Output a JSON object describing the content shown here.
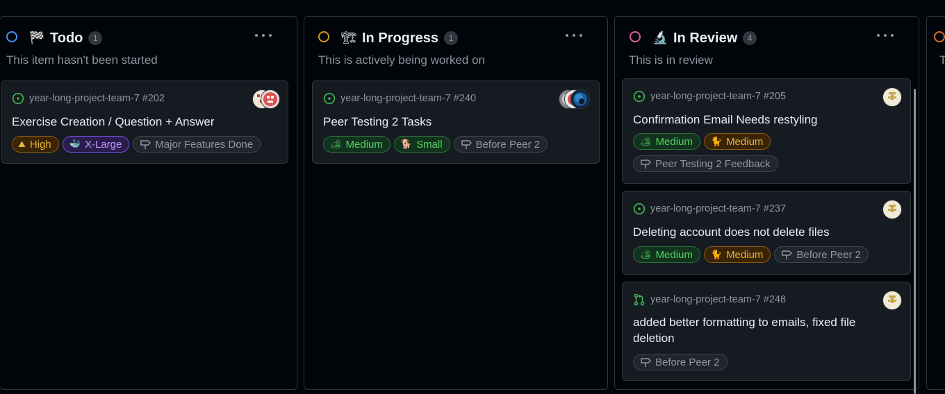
{
  "columns": [
    {
      "title": "Todo",
      "emoji": "🏁",
      "count": "1",
      "description": "This item hasn't been started",
      "ring_color": "#4493f8",
      "cards": [
        {
          "repo_ref": "year-long-project-team-7 #202",
          "title": "Exercise Creation / Question + Answer",
          "labels": [
            {
              "emoji": "⛰",
              "text": "High",
              "style": "orange"
            },
            {
              "emoji": "🐳",
              "text": "X-Large",
              "style": "purple"
            },
            {
              "icon": "milestone",
              "text": "Major Features Done",
              "style": "gray"
            }
          ]
        }
      ]
    },
    {
      "title": "In Progress",
      "emoji": "🏗",
      "count": "1",
      "description": "This is actively being worked on",
      "ring_color": "#d29922",
      "cards": [
        {
          "repo_ref": "year-long-project-team-7 #240",
          "title": "Peer Testing 2 Tasks",
          "labels": [
            {
              "emoji": "🏕",
              "text": "Medium",
              "style": "green"
            },
            {
              "emoji": "🐕",
              "text": "Small",
              "style": "green"
            },
            {
              "icon": "milestone",
              "text": "Before Peer 2",
              "style": "gray"
            }
          ]
        }
      ]
    },
    {
      "title": "In Review",
      "emoji": "🔬",
      "count": "4",
      "description": "This is in review",
      "ring_color": "#db61a2",
      "cards": [
        {
          "repo_ref": "year-long-project-team-7 #205",
          "title": "Confirmation Email Needs restyling",
          "labels": [
            {
              "emoji": "🏕",
              "text": "Medium",
              "style": "green"
            },
            {
              "emoji": "🐈",
              "text": "Medium",
              "style": "orange"
            },
            {
              "icon": "milestone",
              "text": "Peer Testing 2 Feedback",
              "style": "gray"
            }
          ]
        },
        {
          "repo_ref": "year-long-project-team-7 #237",
          "title": "Deleting account does not delete files",
          "labels": [
            {
              "emoji": "🏕",
              "text": "Medium",
              "style": "green"
            },
            {
              "emoji": "🐈",
              "text": "Medium",
              "style": "orange"
            },
            {
              "icon": "milestone",
              "text": "Before Peer 2",
              "style": "gray"
            }
          ]
        },
        {
          "repo_ref": "year-long-project-team-7 #248",
          "title": "added better formatting to emails, fixed file deletion",
          "type": "pull-request",
          "labels": [
            {
              "icon": "milestone",
              "text": "Before Peer 2",
              "style": "gray"
            }
          ]
        }
      ]
    },
    {
      "title": "",
      "emoji": "",
      "count": "",
      "description": "T",
      "ring_color": "#db6d28",
      "cards": []
    }
  ]
}
